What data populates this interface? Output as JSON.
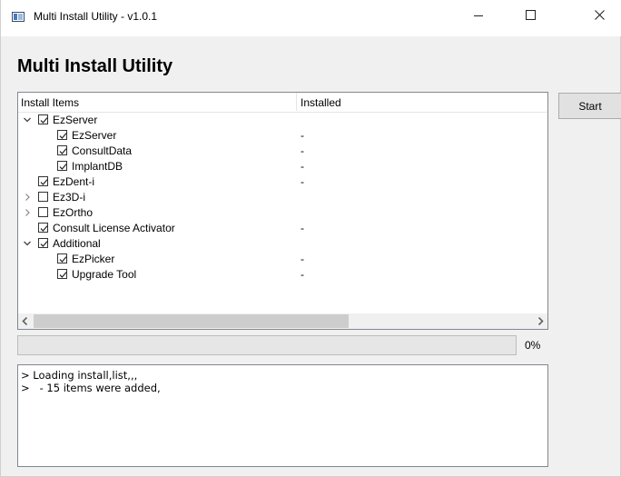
{
  "window": {
    "title": "Multi Install Utility - v1.0.1"
  },
  "heading": "Multi Install Utility",
  "tree": {
    "columns": [
      "Install Items",
      "Installed"
    ],
    "rows": [
      {
        "label": "EzServer",
        "installed": "",
        "checked": true,
        "expander": "expanded",
        "level": 0
      },
      {
        "label": "EzServer",
        "installed": "-",
        "checked": true,
        "expander": "none",
        "level": 1
      },
      {
        "label": "ConsultData",
        "installed": "-",
        "checked": true,
        "expander": "none",
        "level": 1
      },
      {
        "label": "ImplantDB",
        "installed": "-",
        "checked": true,
        "expander": "none",
        "level": 1
      },
      {
        "label": "EzDent-i",
        "installed": "-",
        "checked": true,
        "expander": "none",
        "level": 0
      },
      {
        "label": "Ez3D-i",
        "installed": "",
        "checked": false,
        "expander": "collapsed",
        "level": 0
      },
      {
        "label": "EzOrtho",
        "installed": "",
        "checked": false,
        "expander": "collapsed",
        "level": 0
      },
      {
        "label": "Consult License Activator",
        "installed": "-",
        "checked": true,
        "expander": "none",
        "level": 0
      },
      {
        "label": "Additional",
        "installed": "",
        "checked": true,
        "expander": "expanded",
        "level": 0
      },
      {
        "label": "EzPicker",
        "installed": "-",
        "checked": true,
        "expander": "none",
        "level": 1
      },
      {
        "label": "Upgrade Tool",
        "installed": "-",
        "checked": true,
        "expander": "none",
        "level": 1
      }
    ]
  },
  "start_button": "Start",
  "progress": {
    "value": 0,
    "label": "0%"
  },
  "log": {
    "lines": [
      "> Loading install,list,,,",
      ">   - 15 items were added,"
    ]
  },
  "colors": {
    "window_bg": "#f0f0f0",
    "progress_fill": "#06b025"
  }
}
